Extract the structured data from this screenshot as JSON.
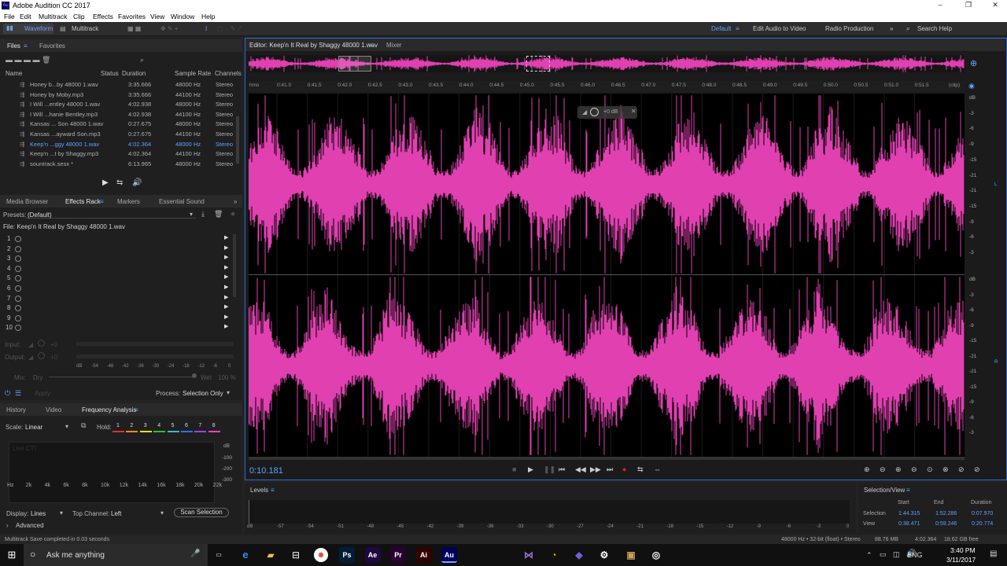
{
  "app": {
    "title": "Adobe Audition CC 2017",
    "logo": "Au"
  },
  "window_controls": {
    "minimize": "–",
    "maximize": "❐",
    "close": "✕"
  },
  "menu": [
    "File",
    "Edit",
    "Multitrack",
    "Clip",
    "Effects",
    "Favorites",
    "View",
    "Window",
    "Help"
  ],
  "toolbar": {
    "waveform": "Waveform",
    "multitrack": "Multitrack",
    "workspace_default": "Default",
    "edit_audio_video": "Edit Audio to Video",
    "radio_production": "Radio Production",
    "more": "»",
    "search_placeholder": "Search Help"
  },
  "files_panel": {
    "tabs": [
      "Files",
      "Favorites"
    ],
    "columns": [
      "Name",
      "Status",
      "Duration",
      "Sample Rate",
      "Channels"
    ],
    "rows": [
      {
        "name": "Honey b...by 48000 1.wav",
        "duration": "3:35.666",
        "rate": "48000 Hz",
        "channels": "Stereo",
        "selected": false
      },
      {
        "name": "Honey by Moby.mp3",
        "duration": "3:35.666",
        "rate": "44100 Hz",
        "channels": "Stereo",
        "selected": false
      },
      {
        "name": "I Will ...entley 48000 1.wav",
        "duration": "4:02.938",
        "rate": "48000 Hz",
        "channels": "Stereo",
        "selected": false
      },
      {
        "name": "I Will ...hanie Bentley.mp3",
        "duration": "4:02.938",
        "rate": "44100 Hz",
        "channels": "Stereo",
        "selected": false
      },
      {
        "name": "Kansas ... Son 48000 1.wav",
        "duration": "0:27.675",
        "rate": "48000 Hz",
        "channels": "Stereo",
        "selected": false
      },
      {
        "name": "Kansas ...ayward Son.mp3",
        "duration": "0:27.675",
        "rate": "44100 Hz",
        "channels": "Stereo",
        "selected": false
      },
      {
        "name": "Keep'n ...ggy 48000 1.wav",
        "duration": "4:02.364",
        "rate": "48000 Hz",
        "channels": "Stereo",
        "selected": true
      },
      {
        "name": "Keep'n ...t by Shaggy.mp3",
        "duration": "4:02.364",
        "rate": "44100 Hz",
        "channels": "Stereo",
        "selected": false
      },
      {
        "name": "sountrack.sesx *",
        "duration": "6:13.965",
        "rate": "48000 Hz",
        "channels": "Stereo",
        "selected": false
      }
    ]
  },
  "effects_panel": {
    "tabs": [
      "Media Browser",
      "Effects Rack",
      "Markers",
      "Essential Sound"
    ],
    "presets_label": "Presets:",
    "presets_value": "(Default)",
    "file_label": "File: Keep'n It Real by Shaggy 48000 1.wav",
    "slots": [
      "1",
      "2",
      "3",
      "4",
      "5",
      "6",
      "7",
      "8",
      "9",
      "10"
    ],
    "input_label": "Input:",
    "output_label": "Output:",
    "mix_label": "Mix:",
    "dry": "Dry",
    "wet": "Wet",
    "zero": "+0",
    "pct": "100 %",
    "meter_ticks": [
      "dB",
      "-54",
      "-48",
      "-42",
      "-36",
      "-30",
      "-24",
      "-18",
      "-12",
      "-6",
      "0"
    ],
    "apply": "Apply",
    "process_label": "Process:",
    "process_value": "Selection Only"
  },
  "freq_panel": {
    "tabs": [
      "History",
      "Video",
      "Frequency Analysis"
    ],
    "scale_label": "Scale:",
    "scale_value": "Linear",
    "hold_label": "Hold:",
    "holds": [
      {
        "n": "1",
        "c": "#e03030"
      },
      {
        "n": "2",
        "c": "#ff8c1a"
      },
      {
        "n": "3",
        "c": "#e6e600"
      },
      {
        "n": "4",
        "c": "#30c030"
      },
      {
        "n": "5",
        "c": "#30c0c0"
      },
      {
        "n": "6",
        "c": "#3070ff"
      },
      {
        "n": "7",
        "c": "#a040ff"
      },
      {
        "n": "8",
        "c": "#ff40c0"
      }
    ],
    "live_label": "Live CTI",
    "db_ticks": [
      "dB",
      "-100",
      "-200",
      "-300"
    ],
    "hz_ticks": [
      "Hz",
      "2k",
      "4k",
      "6k",
      "8k",
      "10k",
      "12k",
      "14k",
      "16k",
      "18k",
      "20k",
      "22k"
    ],
    "display_label": "Display:",
    "display_value": "Lines",
    "topchan_label": "Top Channel:",
    "topchan_value": "Left",
    "scan": "Scan Selection",
    "advanced": "Advanced"
  },
  "editor": {
    "tab": "Editor: Keep'n It Real by Shaggy 48000 1.wav",
    "mixer": "Mixer",
    "ruler_unit": "hms",
    "ruler": [
      "0:41.0",
      "0:41.5",
      "0:42.0",
      "0:42.5",
      "0:43.0",
      "0:43.5",
      "0:44.0",
      "0:44.5",
      "0:45.0",
      "0:45.5",
      "0:46.0",
      "0:46.5",
      "0:47.0",
      "0:47.5",
      "0:48.0",
      "0:48.5",
      "0:49.0",
      "0:49.5",
      "0:50.0",
      "0:50.5",
      "0:51.0",
      "0:51.5"
    ],
    "clip_label": "(clip)",
    "hud": "+0 dB",
    "db_scale_top": [
      "dB",
      "-3",
      "-6",
      "-9",
      "-15",
      "-21",
      "-21",
      "-15",
      "-9",
      "-6",
      "-3"
    ],
    "db_scale_bottom": [
      "dB",
      "-3",
      "-6",
      "-9",
      "-15",
      "-21",
      "-21",
      "-15",
      "-9",
      "-6",
      "-3"
    ],
    "channel_l": "L",
    "channel_r": "R",
    "waveform_color": "#e040b0",
    "time": "0:10.181"
  },
  "levels": {
    "title": "Levels",
    "ticks": [
      "dB",
      "-57",
      "-54",
      "-51",
      "-48",
      "-45",
      "-42",
      "-39",
      "-36",
      "-33",
      "-30",
      "-27",
      "-24",
      "-21",
      "-18",
      "-15",
      "-12",
      "-9",
      "-6",
      "-3",
      "0"
    ]
  },
  "selview": {
    "title": "Selection/View",
    "hdr": [
      "Start",
      "End",
      "Duration"
    ],
    "selection": {
      "label": "Selection",
      "start": "1:44.315",
      "end": "1:52.286",
      "dur": "0:07.970"
    },
    "view": {
      "label": "View",
      "start": "0:38.471",
      "end": "0:59.246",
      "dur": "0:20.774"
    }
  },
  "status": {
    "left": "Multitrack Save completed in 0.03 seconds",
    "format": "48000 Hz • 32-bit (float) • Stereo",
    "size": "88.76 MB",
    "dur": "4:02.364",
    "free": "18.62 GB free"
  },
  "taskbar": {
    "search": "Ask me anything",
    "lang": "ENG",
    "time": "3:40 PM",
    "date": "3/11/2017",
    "apps": [
      {
        "label": "Ps",
        "c": "#001e36"
      },
      {
        "label": "Ae",
        "c": "#1f0740"
      },
      {
        "label": "Pr",
        "c": "#2a0033"
      },
      {
        "label": "Ai",
        "c": "#330000"
      },
      {
        "label": "Au",
        "c": "#00005b"
      }
    ]
  }
}
